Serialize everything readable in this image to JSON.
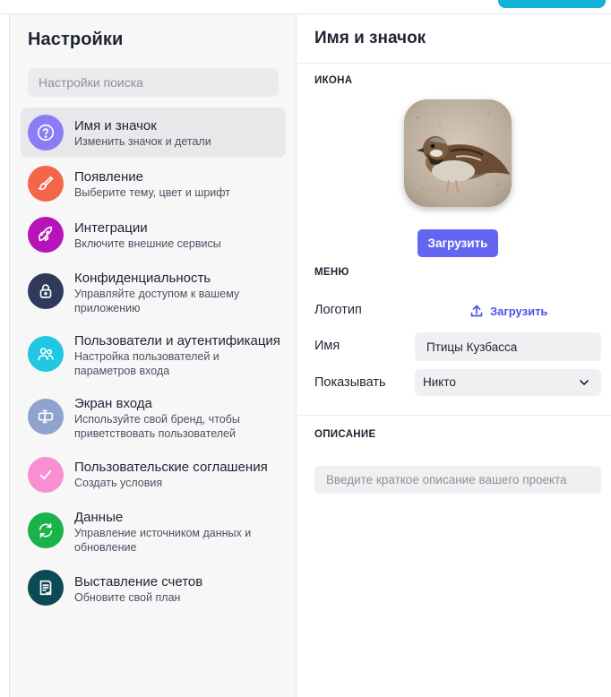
{
  "sidebar": {
    "title": "Настройки",
    "search_placeholder": "Настройки поиска",
    "items": [
      {
        "label": "Имя и значок",
        "desc": "Изменить значок и детали",
        "icon": "help-circle-icon",
        "color": "#8b7cf6",
        "active": true
      },
      {
        "label": "Появление",
        "desc": "Выберите тему, цвет и шрифт",
        "icon": "paintbrush-icon",
        "color": "#f4664a"
      },
      {
        "label": "Интеграции",
        "desc": "Включите внешние сервисы",
        "icon": "rocket-icon",
        "color": "#b613b8"
      },
      {
        "label": "Конфиденциальность",
        "desc": "Управляйте доступом к вашему приложению",
        "icon": "lock-icon",
        "color": "#2f3a5a"
      },
      {
        "label": "Пользователи и аутентификация",
        "desc": "Настройка пользователей и параметров входа",
        "icon": "users-icon",
        "color": "#1fc8e0"
      },
      {
        "label": "Экран входа",
        "desc": "Используйте свой бренд, чтобы приветствовать пользователей",
        "icon": "login-screen-icon",
        "color": "#8fa3cc"
      },
      {
        "label": "Пользовательские соглашения",
        "desc": "Создать условия",
        "icon": "checkmark-icon",
        "color": "#f98fd3"
      },
      {
        "label": "Данные",
        "desc": "Управление источником данных и обновление",
        "icon": "refresh-icon",
        "color": "#19b34a"
      },
      {
        "label": "Выставление счетов",
        "desc": "Обновите свой план",
        "icon": "invoice-icon",
        "color": "#0c4a55"
      }
    ]
  },
  "main": {
    "title": "Имя и значок",
    "icon_section": "ИКОНА",
    "icon_image": "sparrow-photo",
    "upload_label": "Загрузить",
    "menu_section": "МЕНЮ",
    "logo_label": "Логотип",
    "logo_upload_label": "Загрузить",
    "name_label": "Имя",
    "name_value": "Птицы Кузбасса",
    "show_label": "Показывать",
    "show_value": "Никто",
    "description_section": "ОПИСАНИЕ",
    "description_placeholder": "Введите краткое описание вашего проекта"
  },
  "colors": {
    "accent": "#6366f1",
    "link": "#4f52e6",
    "top_button": "#10b3d6"
  }
}
